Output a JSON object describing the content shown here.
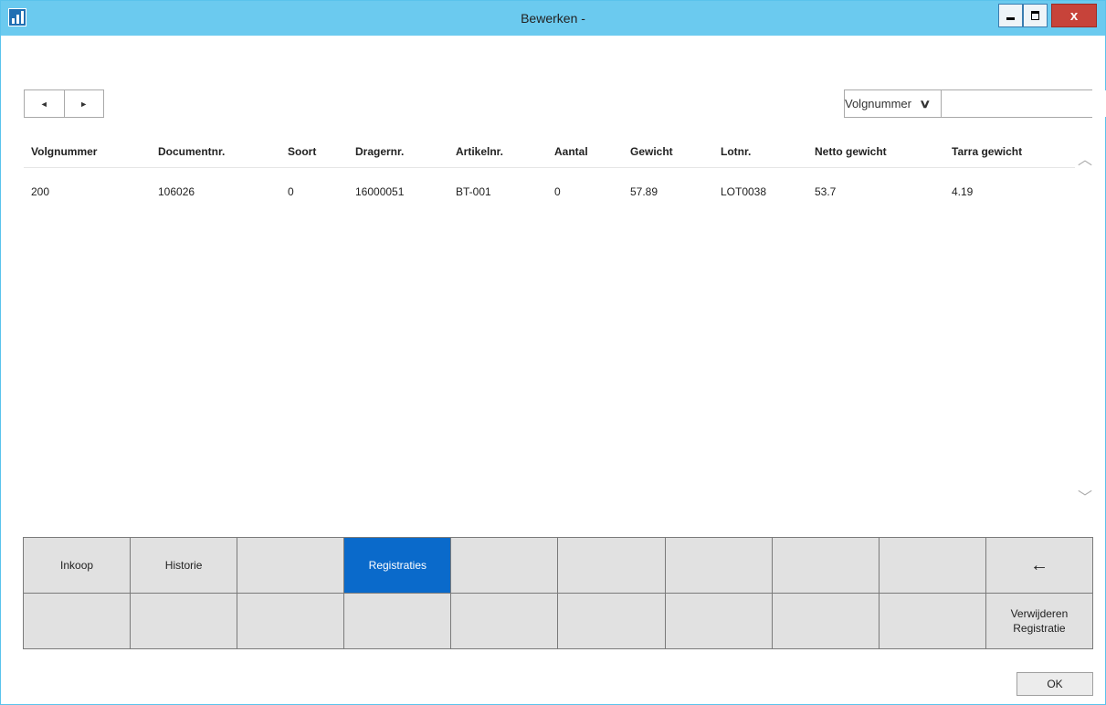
{
  "window": {
    "title": "Bewerken -"
  },
  "nav": {
    "prev_icon": "◄",
    "next_icon": "►"
  },
  "filter": {
    "selected": "Volgnummer",
    "chevron_icon": "chevron-down-icon",
    "search_value": ""
  },
  "table": {
    "columns": [
      "Volgnummer",
      "Documentnr.",
      "Soort",
      "Dragernr.",
      "Artikelnr.",
      "Aantal",
      "Gewicht",
      "Lotnr.",
      "Netto gewicht",
      "Tarra gewicht"
    ],
    "rows": [
      [
        "200",
        "106026",
        "0",
        "16000051",
        "BT-001",
        "0",
        "57.89",
        "LOT0038",
        "53.7",
        "4.19"
      ]
    ]
  },
  "buttons": {
    "row1": [
      "Inkoop",
      "Historie",
      "",
      "Registraties",
      "",
      "",
      "",
      "",
      "",
      "←"
    ],
    "row2": [
      "",
      "",
      "",
      "",
      "",
      "",
      "",
      "",
      "",
      "Verwijderen Registratie"
    ],
    "active": "Registraties"
  },
  "ok_label": "OK",
  "colors": {
    "titlebar": "#6bcaef",
    "active": "#0a6acb",
    "close": "#c7433a"
  }
}
